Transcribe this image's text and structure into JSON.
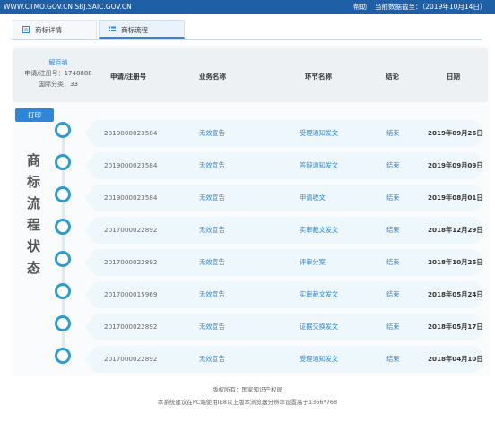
{
  "topbar": {
    "site": "WWW.CTMO.GOV.CN SBJ.SAIC.GOV.CN",
    "help": "帮助",
    "as_of": "当前数据截至：（2019年10月14日）"
  },
  "tabs": [
    {
      "label": "商标详情",
      "icon": "document-icon"
    },
    {
      "label": "商标流程",
      "icon": "list-icon"
    }
  ],
  "info": {
    "name": "解百纳",
    "reg_no": "申请/注册号：1748888",
    "intl_class": "国际分类：33"
  },
  "columns": [
    "申请/注册号",
    "业务名称",
    "环节名称",
    "结论",
    "日期"
  ],
  "print_label": "打印",
  "side_title": [
    "商",
    "标",
    "流",
    "程",
    "状",
    "态"
  ],
  "rows": [
    {
      "num": "2019000023584",
      "biz": "无效宣告",
      "step": "受理通知发文",
      "result": "结束",
      "date": "2019年09月26日"
    },
    {
      "num": "2019000023584",
      "biz": "无效宣告",
      "step": "答辩通知发文",
      "result": "结束",
      "date": "2019年09月09日"
    },
    {
      "num": "2019000023584",
      "biz": "无效宣告",
      "step": "申请收文",
      "result": "结束",
      "date": "2019年08月01日"
    },
    {
      "num": "2017000022892",
      "biz": "无效宣告",
      "step": "实审裁文发文",
      "result": "结束",
      "date": "2018年12月29日"
    },
    {
      "num": "2017000022892",
      "biz": "无效宣告",
      "step": "评审分案",
      "result": "结束",
      "date": "2018年10月25日"
    },
    {
      "num": "2017000015969",
      "biz": "无效宣告",
      "step": "实审裁文发文",
      "result": "结束",
      "date": "2018年05月24日"
    },
    {
      "num": "2017000022892",
      "biz": "无效宣告",
      "step": "证据交换发文",
      "result": "结束",
      "date": "2018年05月17日"
    },
    {
      "num": "2017000022892",
      "biz": "无效宣告",
      "step": "受理通知发文",
      "result": "结束",
      "date": "2018年04月10日"
    }
  ],
  "footer": {
    "copyright": "版权所有：国家知识产权局",
    "note": "本系统建议在PC端使用IE8以上版本浏览器分辨率设置高于1366*768"
  },
  "colors": {
    "accent": "#2d86d8",
    "topbar": "#1f5fa6",
    "circle": "#2d9ccf"
  }
}
